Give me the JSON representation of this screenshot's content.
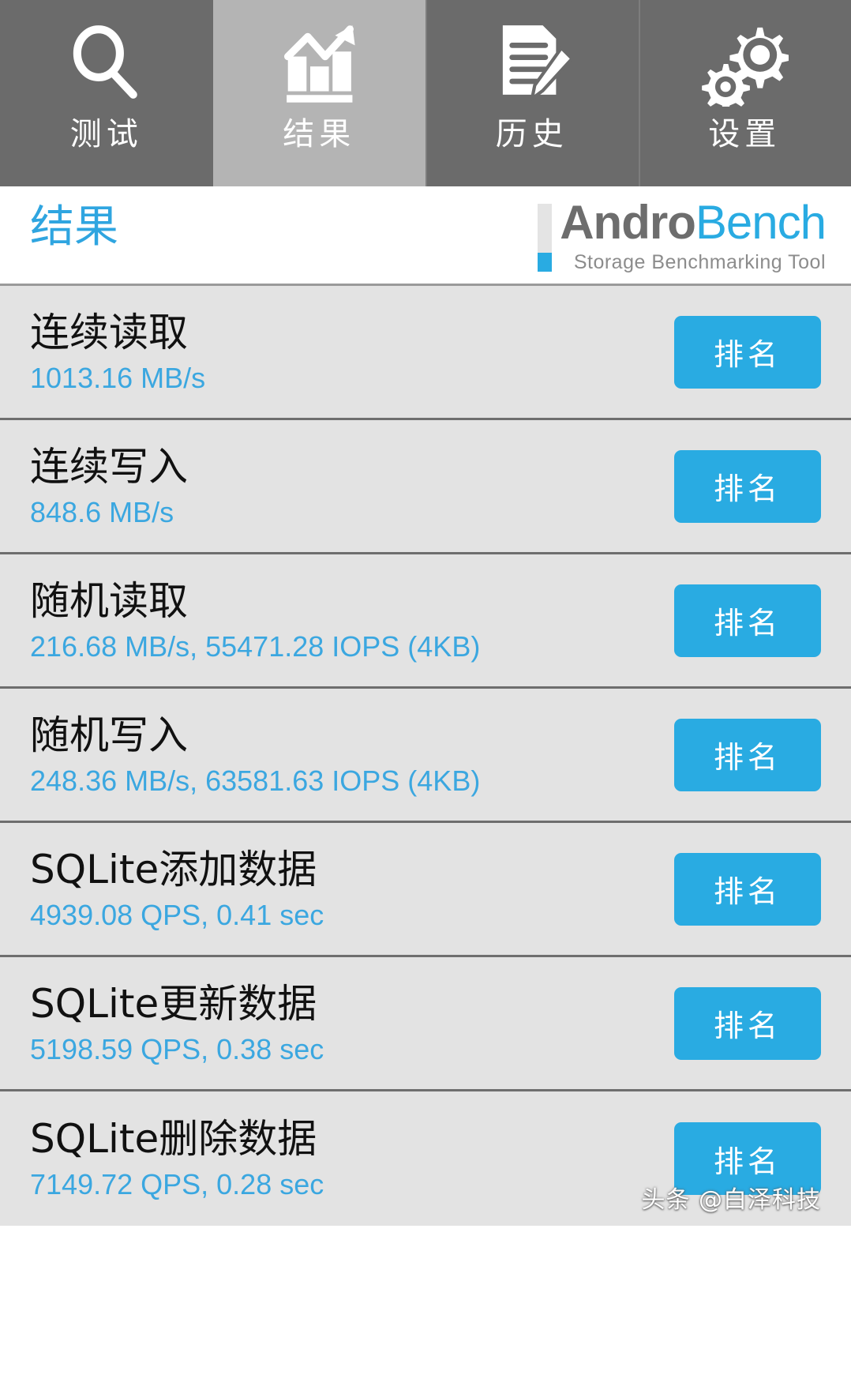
{
  "tabs": [
    {
      "label": "测试",
      "icon": "search-icon",
      "active": false
    },
    {
      "label": "结果",
      "icon": "chart-icon",
      "active": true
    },
    {
      "label": "历史",
      "icon": "document-edit-icon",
      "active": false
    },
    {
      "label": "设置",
      "icon": "gears-icon",
      "active": false
    }
  ],
  "header": {
    "page_title": "结果",
    "logo_andro": "Andro",
    "logo_bench": "Bench",
    "logo_subtitle": "Storage Benchmarking Tool"
  },
  "results": [
    {
      "name": "连续读取",
      "value": "1013.16 MB/s",
      "rank_label": "排名"
    },
    {
      "name": "连续写入",
      "value": "848.6 MB/s",
      "rank_label": "排名"
    },
    {
      "name": "随机读取",
      "value": "216.68 MB/s, 55471.28 IOPS (4KB)",
      "rank_label": "排名"
    },
    {
      "name": "随机写入",
      "value": "248.36 MB/s, 63581.63 IOPS (4KB)",
      "rank_label": "排名"
    },
    {
      "name": "SQLite添加数据",
      "value": "4939.08 QPS, 0.41 sec",
      "rank_label": "排名"
    },
    {
      "name": "SQLite更新数据",
      "value": "5198.59 QPS, 0.38 sec",
      "rank_label": "排名"
    },
    {
      "name": "SQLite删除数据",
      "value": "7149.72 QPS, 0.28 sec",
      "rank_label": "排名"
    }
  ],
  "watermark": "头条 @白泽科技",
  "colors": {
    "accent_blue": "#29abe2",
    "value_blue": "#3ba7e0",
    "tab_bg": "#6b6b6b",
    "tab_active_bg": "#b4b4b4",
    "list_bg": "#e3e3e3",
    "row_divider": "#6e6e6e",
    "logo_gray": "#6d6d6d"
  }
}
